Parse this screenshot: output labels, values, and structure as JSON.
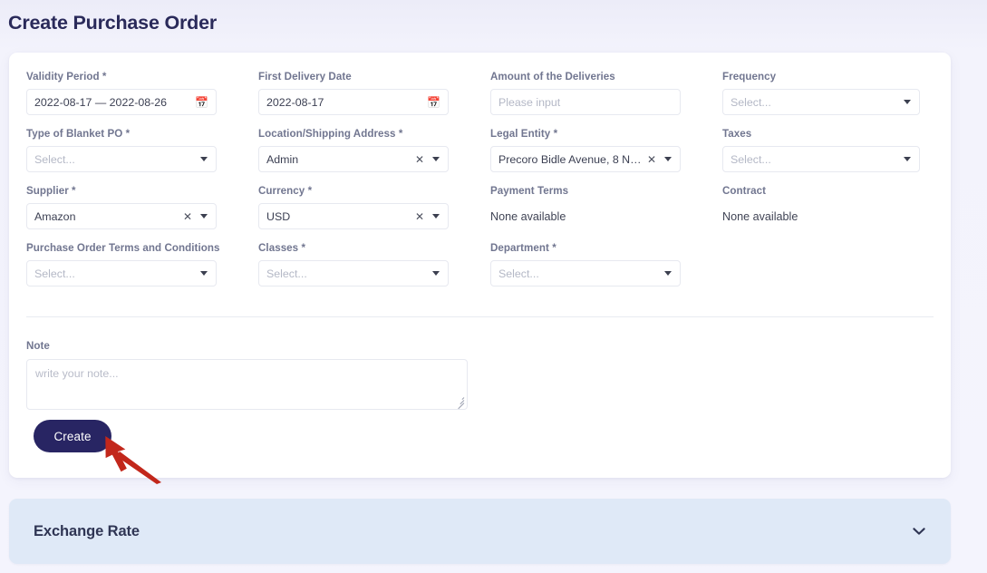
{
  "page": {
    "title": "Create Purchase Order"
  },
  "form": {
    "fields": [
      {
        "name": "validity-period",
        "label": "Validity Period",
        "required": true,
        "type": "date-range",
        "value": "2022-08-17 — 2022-08-26",
        "icon": "calendar-icon"
      },
      {
        "name": "first-delivery-date",
        "label": "First Delivery Date",
        "required": false,
        "type": "date",
        "value": "2022-08-17",
        "icon": "calendar-icon"
      },
      {
        "name": "amount-of-the-deliveries",
        "label": "Amount of the Deliveries",
        "required": false,
        "type": "text",
        "value": "",
        "placeholder": "Please input"
      },
      {
        "name": "frequency",
        "label": "Frequency",
        "required": false,
        "type": "select",
        "value": "",
        "placeholder": "Select...",
        "clearable": false
      },
      {
        "name": "type-of-blanket-po",
        "label": "Type of Blanket PO",
        "required": true,
        "type": "select",
        "value": "",
        "placeholder": "Select...",
        "clearable": false
      },
      {
        "name": "location-shipping-address",
        "label": "Location/Shipping Address",
        "required": true,
        "type": "select",
        "value": "Admin",
        "placeholder": "Select...",
        "clearable": true
      },
      {
        "name": "legal-entity",
        "label": "Legal Entity",
        "required": true,
        "type": "select",
        "value": "Precoro Bidle Avenue, 8 New Y…",
        "placeholder": "Select...",
        "clearable": true
      },
      {
        "name": "taxes",
        "label": "Taxes",
        "required": false,
        "type": "select",
        "value": "",
        "placeholder": "Select...",
        "clearable": false
      },
      {
        "name": "supplier",
        "label": "Supplier",
        "required": true,
        "type": "select",
        "value": "Amazon",
        "placeholder": "Select...",
        "clearable": true
      },
      {
        "name": "currency",
        "label": "Currency",
        "required": true,
        "type": "select",
        "value": "USD",
        "placeholder": "Select...",
        "clearable": true
      },
      {
        "name": "payment-terms",
        "label": "Payment Terms",
        "required": false,
        "type": "static",
        "value": "None available"
      },
      {
        "name": "contract",
        "label": "Contract",
        "required": false,
        "type": "static",
        "value": "None available"
      },
      {
        "name": "purchase-order-terms-and-conditions",
        "label": "Purchase Order Terms and Conditions",
        "required": false,
        "type": "select",
        "value": "",
        "placeholder": "Select...",
        "clearable": false
      },
      {
        "name": "classes",
        "label": "Classes",
        "required": true,
        "type": "select",
        "value": "",
        "placeholder": "Select...",
        "clearable": false
      },
      {
        "name": "department",
        "label": "Department",
        "required": true,
        "type": "select",
        "value": "",
        "placeholder": "Select...",
        "clearable": false
      },
      {
        "name": "spacer",
        "label": "",
        "required": false,
        "type": "empty",
        "value": ""
      }
    ],
    "required_marker": "*"
  },
  "note": {
    "label": "Note",
    "value": "",
    "placeholder": "write your note..."
  },
  "actions": {
    "create_label": "Create"
  },
  "exchange": {
    "title": "Exchange Rate",
    "chevron": "chevron-down-icon"
  },
  "annotation": {
    "arrow": "red-arrow-pointer",
    "color": "#c2271b"
  },
  "colors": {
    "page_bg": "#f3f3fc",
    "card_bg": "#ffffff",
    "title": "#2a2a5a",
    "label": "#717690",
    "button": "#282563",
    "panel": "#dfe9f7",
    "calendar_icon": "#4a90e2"
  }
}
